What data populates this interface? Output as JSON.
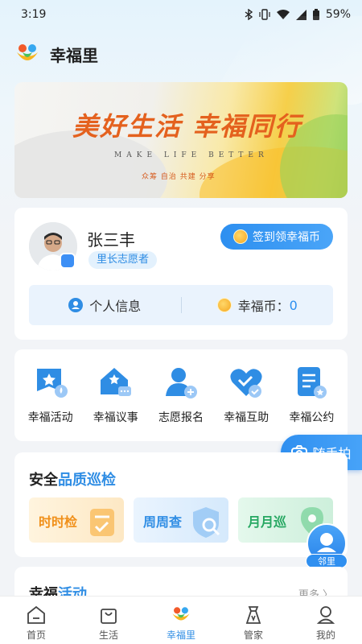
{
  "status_bar": {
    "time": "3:19",
    "battery": "59%"
  },
  "header": {
    "title": "幸福里"
  },
  "banner": {
    "title": "美好生活 幸福同行",
    "subtitle": "MAKE LIFE BETTER",
    "tags": "众筹 自治 共建 分享"
  },
  "profile": {
    "name": "张三丰",
    "role": "里长志愿者",
    "checkin_label": "签到领幸福币",
    "personal_info_label": "个人信息",
    "coin_label": "幸福币：",
    "coin_value": "0"
  },
  "services": [
    {
      "label": "幸福活动",
      "icon": "activity-flag-icon"
    },
    {
      "label": "幸福议事",
      "icon": "discussion-house-icon"
    },
    {
      "label": "志愿报名",
      "icon": "volunteer-person-icon"
    },
    {
      "label": "幸福互助",
      "icon": "mutual-aid-heart-icon"
    },
    {
      "label": "幸福公约",
      "icon": "convention-document-icon"
    }
  ],
  "float_button": {
    "label": "随手拍"
  },
  "inspection": {
    "title_prefix": "安全",
    "title_accent": "品质巡检",
    "tiles": [
      {
        "label": "时时检"
      },
      {
        "label": "周周查"
      },
      {
        "label": "月月巡"
      }
    ]
  },
  "neighbor_button": {
    "label": "邻里"
  },
  "activity_section": {
    "title_prefix": "幸福",
    "title_accent": "活动",
    "more_label": "更多 〉"
  },
  "tab_bar": {
    "tabs": [
      {
        "label": "首页",
        "icon": "home-icon"
      },
      {
        "label": "生活",
        "icon": "shopping-bag-icon"
      },
      {
        "label": "幸福里",
        "icon": "xingfuli-logo-icon",
        "active": true
      },
      {
        "label": "管家",
        "icon": "butler-icon"
      },
      {
        "label": "我的",
        "icon": "profile-icon"
      }
    ]
  },
  "colors": {
    "accent": "#2f8de4",
    "banner_title": "#e4611e",
    "tile_orange": "#f0901a",
    "tile_green": "#26a862"
  }
}
